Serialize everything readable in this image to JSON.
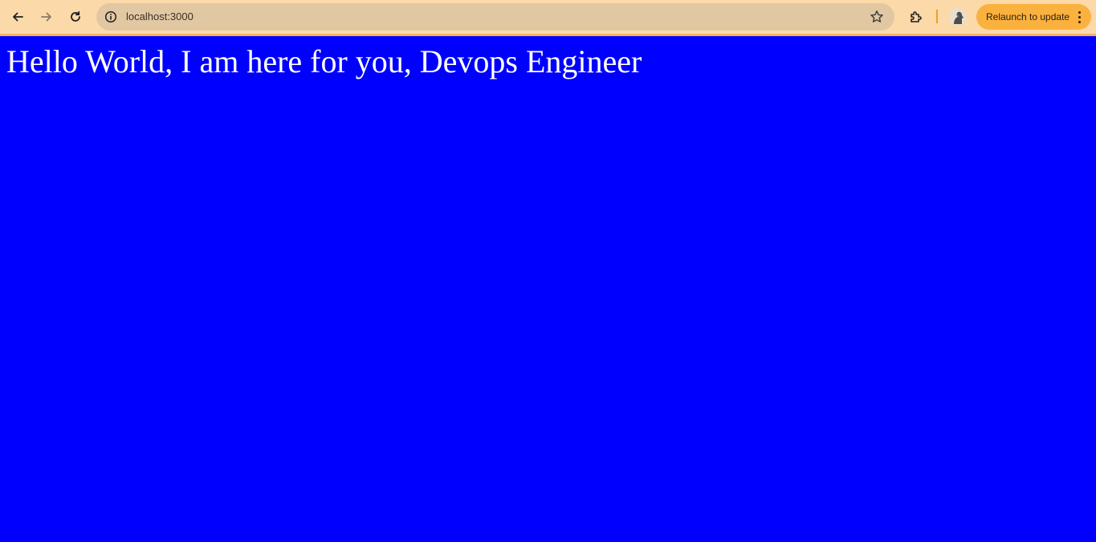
{
  "browser": {
    "address_bar": {
      "url": "localhost:3000"
    },
    "relaunch_label": "Relaunch to update",
    "colors": {
      "toolbar": "#fcd9a8",
      "omnibox": "#e1c7a2",
      "relaunch": "#fbb13e"
    }
  },
  "page": {
    "background": "#0000ff",
    "heading": "Hello World, I am here for you, Devops Engineer"
  }
}
